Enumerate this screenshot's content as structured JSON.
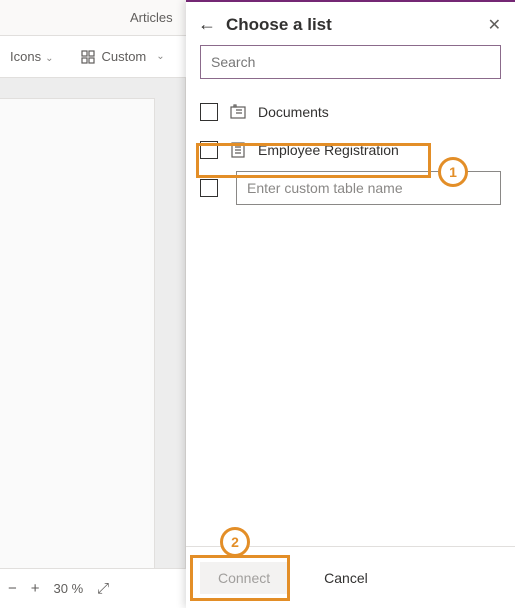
{
  "bg": {
    "tab_label": "Articles",
    "toolbar": {
      "icons_label": "Icons",
      "custom_label": "Custom"
    },
    "status": {
      "minus": "−",
      "plus": "+",
      "zoom": "30  %",
      "expand": "⤢"
    }
  },
  "panel": {
    "back_glyph": "←",
    "title": "Choose a list",
    "close_glyph": "✕",
    "search_placeholder": "Search",
    "lists": [
      {
        "label": "Documents"
      },
      {
        "label": "Employee Registration"
      }
    ],
    "custom_placeholder": "Enter custom table name",
    "footer": {
      "connect_label": "Connect",
      "cancel_label": "Cancel"
    }
  },
  "annotations": {
    "one": "1",
    "two": "2"
  }
}
